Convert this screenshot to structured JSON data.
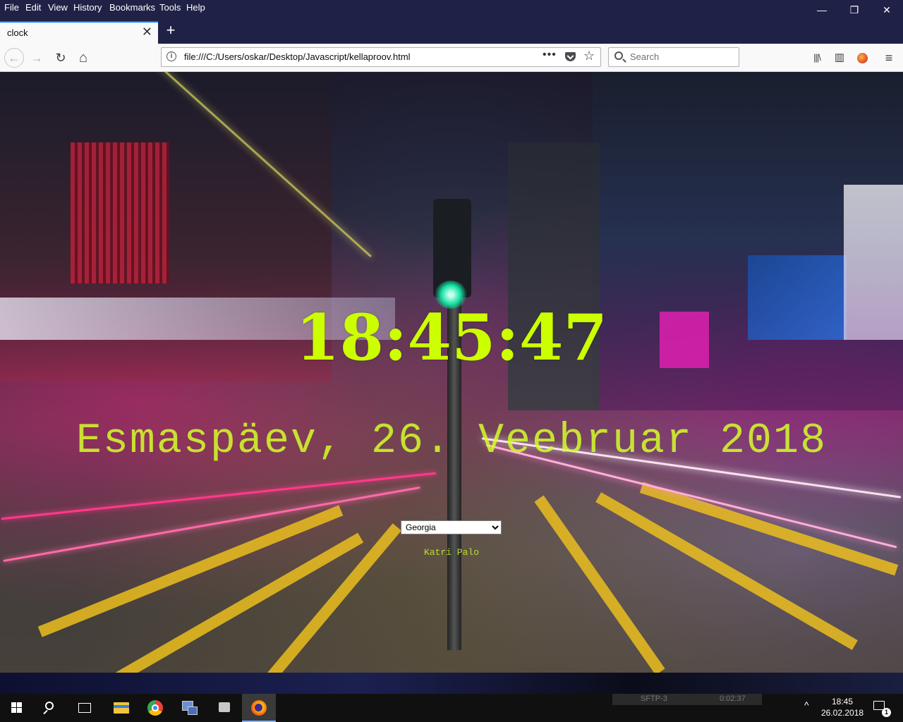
{
  "menubar": {
    "items": [
      "File",
      "Edit",
      "View",
      "History",
      "Bookmarks",
      "Tools",
      "Help"
    ],
    "window_controls": {
      "minimize": "—",
      "restore": "❐",
      "close": "✕"
    }
  },
  "tab": {
    "title": "clock",
    "close": "✕",
    "new_tab": "+"
  },
  "navbar": {
    "back": "←",
    "forward": "→",
    "reload": "↻",
    "home": "⌂",
    "url": "file:///C:/Users/oskar/Desktop/Javascript/kellaproov.html",
    "url_info": "i",
    "page_actions": "•••",
    "bookmark_star": "☆",
    "search_placeholder": "Search",
    "library": "|||\\",
    "sidebar": "▥",
    "menu": "≡"
  },
  "page": {
    "time": "18:45:47",
    "date": "Esmaspäev, 26. Veebruar 2018",
    "font_select": {
      "selected": "Georgia"
    },
    "author": "Katri Palo"
  },
  "taskbar": {
    "ghost_window": {
      "title": "SFTP-3",
      "timer": "0:02:37"
    },
    "clock_time": "18:45",
    "clock_date": "26.02.2018",
    "notification_count": "1",
    "tray_arrow": "^"
  },
  "colors": {
    "clock_text": "#ccff00",
    "firefox_chrome_dark": "#1f2246",
    "tab_highlight": "#0a84ff"
  }
}
